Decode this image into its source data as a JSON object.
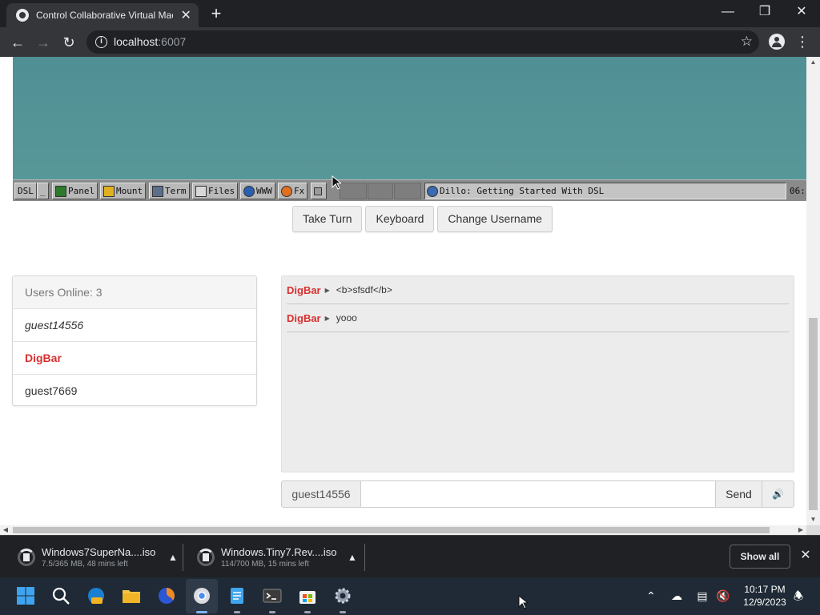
{
  "browser": {
    "tab_title": "Control Collaborative Virtual Machine",
    "tab_close": "✕",
    "new_tab": "+",
    "url_host": "localhost",
    "url_port": ":6007",
    "window_controls": {
      "minimize": "—",
      "restore": "❐",
      "close": "✕"
    }
  },
  "vm": {
    "taskbar_buttons": [
      {
        "label": "DSL"
      },
      {
        "label": "_"
      },
      {
        "label": "Panel"
      },
      {
        "label": "Mount"
      },
      {
        "label": "Term"
      },
      {
        "label": "Files"
      },
      {
        "label": "WWW"
      },
      {
        "label": "Fx"
      }
    ],
    "window_title": "Dillo: Getting Started With DSL",
    "clock": "06:"
  },
  "controls": {
    "take_turn": "Take Turn",
    "keyboard": "Keyboard",
    "change_username": "Change Username"
  },
  "users": {
    "header": "Users Online: 3",
    "list": [
      {
        "name": "guest14556"
      },
      {
        "name": "DigBar"
      },
      {
        "name": "guest7669"
      }
    ]
  },
  "chat": {
    "messages": [
      {
        "user": "DigBar",
        "text": "<b>sfsdf</b>"
      },
      {
        "user": "DigBar",
        "text": "yooo"
      }
    ],
    "username": "guest14556",
    "input_value": "",
    "send_label": "Send",
    "volume_icon": "🔊"
  },
  "downloads": {
    "items": [
      {
        "name": "Windows7SuperNa....iso",
        "status": "7.5/365 MB, 48 mins left"
      },
      {
        "name": "Windows.Tiny7.Rev....iso",
        "status": "114/700 MB, 15 mins left"
      }
    ],
    "show_all": "Show all",
    "close": "✕"
  },
  "taskbar": {
    "time": "10:17 PM",
    "date": "12/9/2023"
  },
  "colors": {
    "admin_red": "#d9302f",
    "vm_teal": "#5a9999",
    "chrome_dark": "#202124"
  }
}
